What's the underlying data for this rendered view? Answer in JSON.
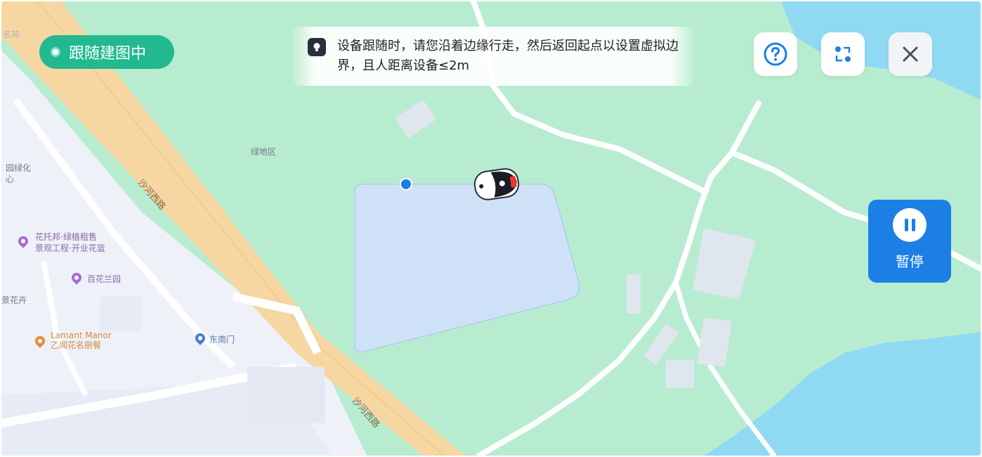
{
  "status": {
    "label": "跟随建图中"
  },
  "tip": {
    "icon": "lightbulb-icon",
    "text": "设备跟随时，请您沿着边缘行走，然后返回起点以设置虚拟边界，且人距离设备≤2m"
  },
  "toolbar": {
    "help_icon": "help-icon",
    "switch_icon": "switch-view-icon",
    "close_icon": "close-icon"
  },
  "pause": {
    "label": "暂停",
    "icon": "pause-icon"
  },
  "map": {
    "labels": {
      "green_area": "绿地区",
      "road_north": "沙河西路",
      "road_south": "沙河西路",
      "poi1": "花托邦·绿植租售",
      "poi1_line2": "景观工程·开业花篮",
      "poi2": "百花兰园",
      "poi3": "东南门",
      "poi4_line1": "Lamant Manor",
      "poi4_line2": "乙闻花名厨餐",
      "edge1": "园绿化",
      "edge2": "心",
      "edge3": "景花卉",
      "edge4": "名苑"
    },
    "colors": {
      "grass": "#b8ecd0",
      "water": "#8fd9f3",
      "road": "#f6d7a2",
      "urban": "#eef1f8",
      "zone": "#cfe1f7",
      "zone_border": "#9fc3ee",
      "accent": "#1b7fe6",
      "status": "#22b990"
    }
  }
}
